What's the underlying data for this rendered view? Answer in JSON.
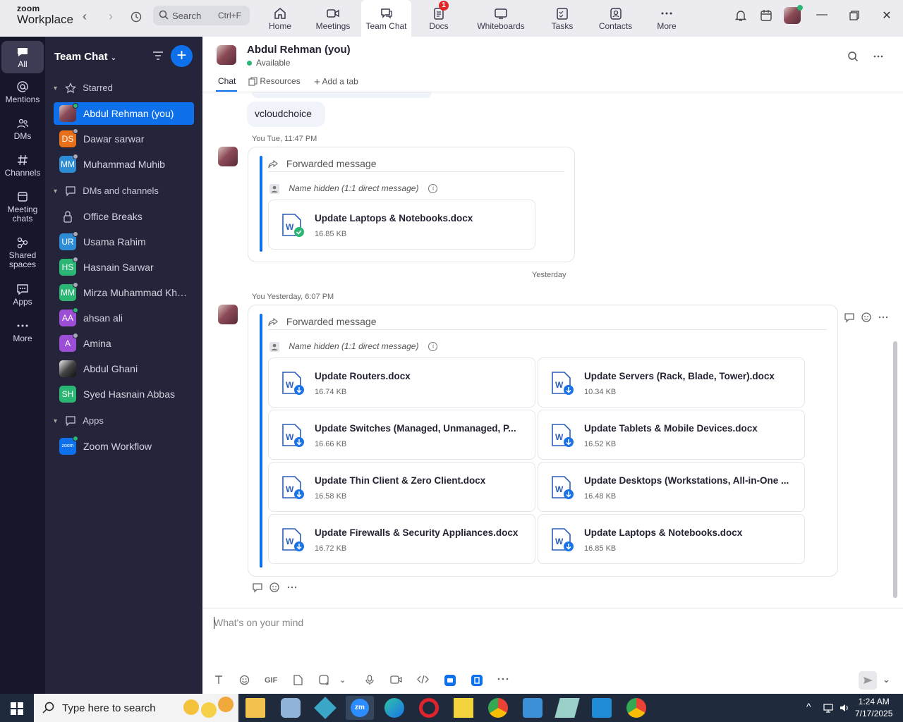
{
  "brand": {
    "line1": "zoom",
    "line2": "Workplace"
  },
  "search": {
    "label": "Search",
    "shortcut": "Ctrl+F"
  },
  "nav_tabs": [
    {
      "label": "Home",
      "icon": "home-icon"
    },
    {
      "label": "Meetings",
      "icon": "video-icon"
    },
    {
      "label": "Team Chat",
      "icon": "chat-icon",
      "active": true
    },
    {
      "label": "Docs",
      "icon": "docs-icon",
      "badge": "1"
    },
    {
      "label": "Whiteboards",
      "icon": "whiteboard-icon"
    },
    {
      "label": "Tasks",
      "icon": "tasks-icon"
    },
    {
      "label": "Contacts",
      "icon": "contacts-icon"
    },
    {
      "label": "More",
      "icon": "more-icon"
    }
  ],
  "rail": [
    {
      "label": "All",
      "icon": "chat-bubble-icon",
      "active": true
    },
    {
      "label": "Mentions",
      "icon": "at-icon"
    },
    {
      "label": "DMs",
      "icon": "people-icon"
    },
    {
      "label": "Channels",
      "icon": "hash-icon"
    },
    {
      "label": "Meeting chats",
      "icon": "calendar-icon"
    },
    {
      "label": "Shared spaces",
      "icon": "share-icon"
    },
    {
      "label": "Apps",
      "icon": "apps-icon"
    },
    {
      "label": "More",
      "icon": "ellipsis-icon"
    }
  ],
  "sidebar": {
    "title": "Team Chat",
    "sections": {
      "starred": "Starred",
      "dms": "DMs and channels",
      "apps": "Apps"
    },
    "starred": [
      {
        "name": "Abdul Rehman (you)",
        "initials": "",
        "color": "photo",
        "status": "online",
        "selected": true
      },
      {
        "name": "Dawar sarwar",
        "initials": "DS",
        "color": "#e8701a",
        "status": "away"
      },
      {
        "name": "Muhammad Muhib",
        "initials": "MM",
        "color": "#2d8cd4",
        "status": "away"
      }
    ],
    "dms": [
      {
        "name": "Office Breaks",
        "initials": "",
        "color": "lock",
        "status": ""
      },
      {
        "name": "Usama Rahim",
        "initials": "UR",
        "color": "#2d8cd4",
        "status": "away"
      },
      {
        "name": "Hasnain Sarwar",
        "initials": "HS",
        "color": "#2bb673",
        "status": "away"
      },
      {
        "name": "Mirza Muhammad Khur...",
        "initials": "MM",
        "color": "#2bb673",
        "status": "away"
      },
      {
        "name": "ahsan ali",
        "initials": "AA",
        "color": "#9c4fd6",
        "status": "online"
      },
      {
        "name": "Amina",
        "initials": "A",
        "color": "#9c4fd6",
        "status": "away"
      },
      {
        "name": "Abdul Ghani",
        "initials": "",
        "color": "photo2",
        "status": ""
      },
      {
        "name": "Syed Hasnain Abbas",
        "initials": "SH",
        "color": "#2bb673",
        "status": ""
      }
    ],
    "apps": [
      {
        "name": "Zoom Workflow",
        "initials": "zoom",
        "color": "#0e71eb",
        "status": "online"
      }
    ]
  },
  "chat": {
    "contact_name": "Abdul Rehman (you)",
    "contact_status": "Available",
    "tabs": {
      "chat": "Chat",
      "resources": "Resources",
      "add": "Add a tab"
    },
    "bubble_text": "vcloudchoice",
    "msg1": {
      "timestamp": "You Tue, 11:47 PM",
      "forwarded_label": "Forwarded message",
      "sender": "Name hidden (1:1 direct message)",
      "files": [
        {
          "name": "Update Laptops & Notebooks.docx",
          "size": "16.85 KB",
          "state": "done"
        }
      ]
    },
    "divider": "Yesterday",
    "msg2": {
      "timestamp": "You Yesterday, 6:07 PM",
      "forwarded_label": "Forwarded message",
      "sender": "Name hidden (1:1 direct message)",
      "files": [
        {
          "name": "Update Routers.docx",
          "size": "16.74 KB"
        },
        {
          "name": "Update Servers (Rack, Blade, Tower).docx",
          "size": "10.34 KB"
        },
        {
          "name": "Update Switches (Managed, Unmanaged, P...",
          "size": "16.66 KB"
        },
        {
          "name": "Update Tablets & Mobile Devices.docx",
          "size": "16.52 KB"
        },
        {
          "name": "Update Thin Client & Zero Client.docx",
          "size": "16.58 KB"
        },
        {
          "name": "Update Desktops (Workstations, All-in-One ...",
          "size": "16.48 KB"
        },
        {
          "name": "Update Firewalls & Security Appliances.docx",
          "size": "16.72 KB"
        },
        {
          "name": "Update Laptops & Notebooks.docx",
          "size": "16.85 KB"
        }
      ]
    },
    "composer_placeholder": "What's on your mind",
    "gif_label": "GIF"
  },
  "taskbar": {
    "search_placeholder": "Type here to search",
    "time": "1:24 AM",
    "date": "7/17/2025"
  }
}
